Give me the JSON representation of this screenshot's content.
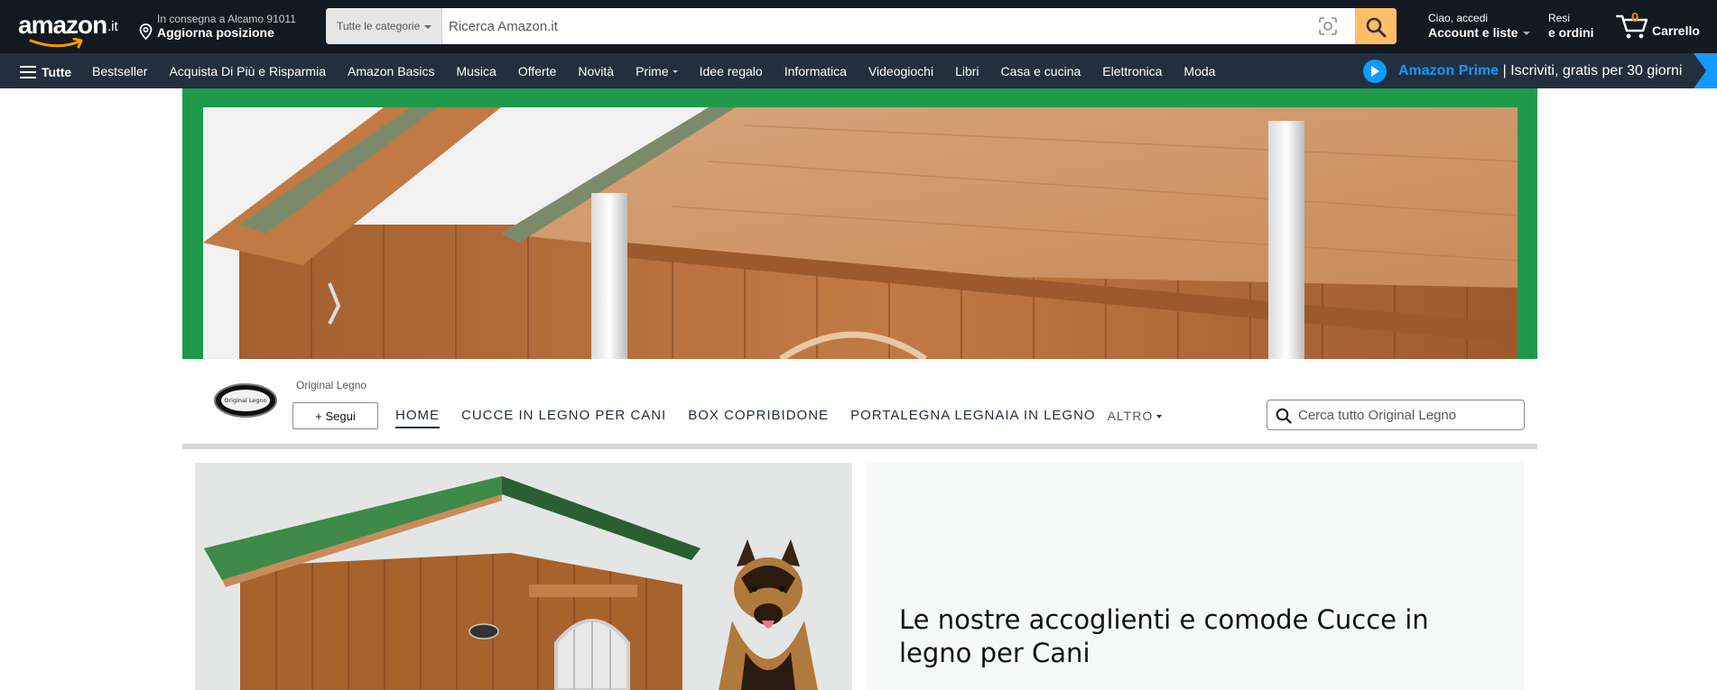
{
  "header": {
    "logo_text": "amazon",
    "logo_tld": ".it",
    "deliver_line1": "In consegna a Alcamo 91011",
    "deliver_line2": "Aggiorna posizione",
    "search": {
      "category": "Tutte le categorie",
      "placeholder": "Ricerca Amazon.it"
    },
    "account_line1": "Ciao, accedi",
    "account_line2": "Account e liste",
    "orders_line1": "Resi",
    "orders_line2": "e ordini",
    "cart_count": "0",
    "cart_label": "Carrello"
  },
  "subnav": {
    "all_label": "Tutte",
    "links": [
      "Bestseller",
      "Acquista Di Più e Risparmia",
      "Amazon Basics",
      "Musica",
      "Offerte",
      "Novità",
      "Prime",
      "Idee regalo",
      "Informatica",
      "Videogiochi",
      "Libri",
      "Casa e cucina",
      "Elettronica",
      "Moda"
    ],
    "prime_brand": "Amazon Prime",
    "prime_text": " | Iscriviti, gratis per 30 giorni"
  },
  "store": {
    "brand_name": "Original Legno",
    "logo_text": "Original Legno",
    "follow_label": "+ Segui",
    "tabs": [
      "HOME",
      "CUCCE IN LEGNO PER CANI",
      "BOX COPRIBIDONE",
      "PORTALEGNA LEGNAIA IN LEGNO"
    ],
    "more_label": "ALTRO",
    "search_placeholder": "Cerca tutto Original Legno"
  },
  "tile": {
    "heading": "Le nostre accoglienti e comode Cucce in legno per Cani"
  },
  "colors": {
    "nav_dark": "#131921",
    "nav_sub": "#232f3e",
    "search_button": "#febd69",
    "cart_count": "#f08804",
    "prime_blue": "#1399ff",
    "banner_green": "#1e9a4a"
  }
}
